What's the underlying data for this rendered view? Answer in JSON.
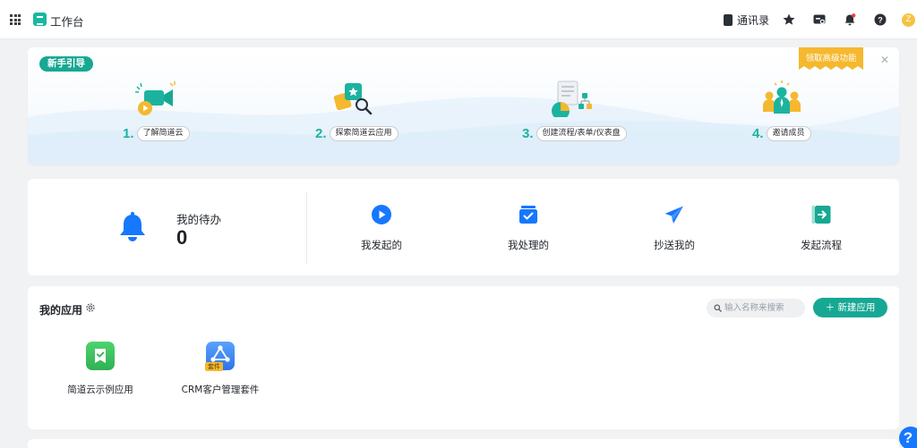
{
  "topbar": {
    "title": "工作台",
    "contacts_label": "通讯录",
    "icons": [
      "apps-grid-icon",
      "workspace-logo-icon",
      "contacts-book-icon",
      "star-icon",
      "message-card-icon",
      "bell-icon",
      "help-icon",
      "avatar"
    ],
    "avatar_letter": "Z",
    "bell_has_dot": true
  },
  "guide": {
    "badge": "新手引导",
    "upgrade_label": "领取高级功能",
    "close_icon": "close-icon",
    "steps": [
      {
        "num": "1.",
        "label": "了解简道云"
      },
      {
        "num": "2.",
        "label": "探索简道云应用"
      },
      {
        "num": "3.",
        "label": "创建流程/表单/仪表盘"
      },
      {
        "num": "4.",
        "label": "邀请成员"
      }
    ]
  },
  "todo": {
    "title": "我的待办",
    "count": "0",
    "actions": [
      {
        "label": "我发起的",
        "icon": "play-circle-icon"
      },
      {
        "label": "我处理的",
        "icon": "inbox-check-icon"
      },
      {
        "label": "抄送我的",
        "icon": "paper-plane-icon"
      },
      {
        "label": "发起流程",
        "icon": "start-flow-icon"
      }
    ]
  },
  "apps": {
    "title": "我的应用",
    "search_placeholder": "输入名称来搜索",
    "new_button": "新建应用",
    "items": [
      {
        "name": "简道云示例应用",
        "color": "#3cc35f"
      },
      {
        "name": "CRM客户管理套件",
        "color": "#3a86f5",
        "tag": "套件"
      }
    ]
  },
  "colors": {
    "accent": "#17a894",
    "blue": "#1677ff",
    "upgrade": "#f5b82e"
  }
}
